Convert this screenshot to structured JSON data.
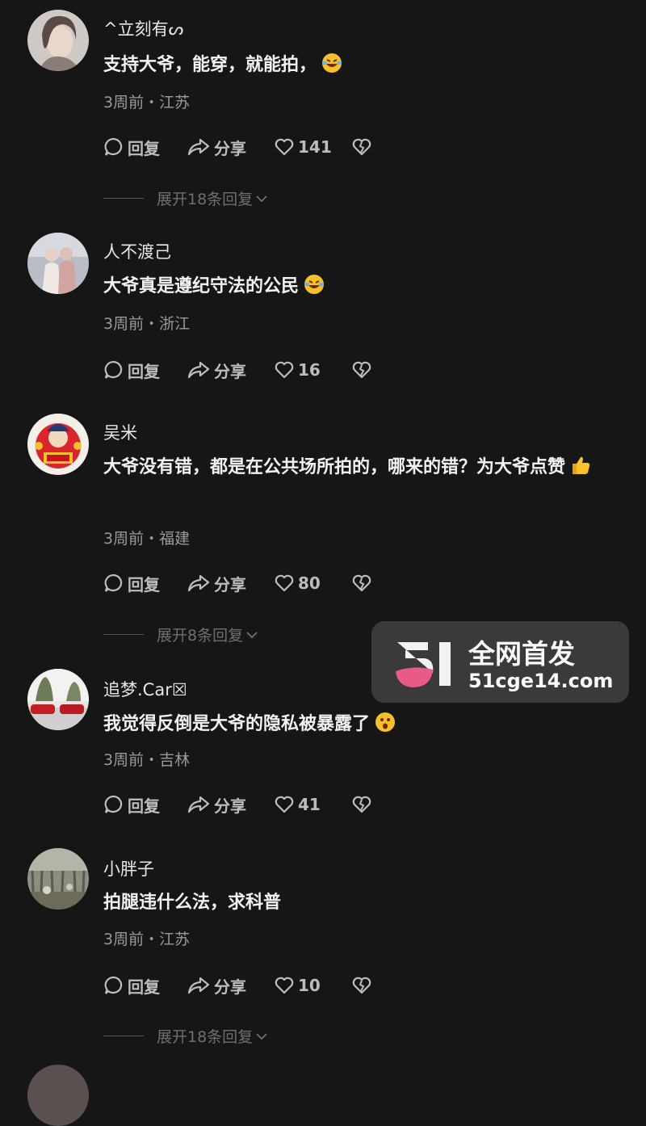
{
  "colors": {
    "background": "#161616",
    "text": "#f2f2f2",
    "meta": "#9a9a9a",
    "action": "#bdbdbd",
    "expand": "#6f6f6f",
    "watermark_bg": "#3c3c3c",
    "watermark_accent": "#e85b85"
  },
  "comments": [
    {
      "username": "^立刻有ᔕ",
      "text": "支持大爷，能穿，就能拍，",
      "emoji": "laughing-crying-emoji",
      "meta": "3周前・江苏",
      "actions": {
        "reply": "回复",
        "share": "分享",
        "likes": "141"
      },
      "expand": "展开18条回复"
    },
    {
      "username": "人不渡己",
      "text": "大爷真是遵纪守法的公民",
      "emoji": "laughing-crying-emoji",
      "meta": "3周前・浙江",
      "actions": {
        "reply": "回复",
        "share": "分享",
        "likes": "16"
      }
    },
    {
      "username": "吴米",
      "text": "大爷没有错，都是在公共场所拍的，哪来的错？为大爷点赞",
      "emoji": "thumbs-up-emoji",
      "meta": "3周前・福建",
      "actions": {
        "reply": "回复",
        "share": "分享",
        "likes": "80"
      },
      "expand": "展开8条回复"
    },
    {
      "username": "追梦.Car☒",
      "text": "我觉得反倒是大爷的隐私被暴露了",
      "emoji": "hushed-face-emoji",
      "meta": "3周前・吉林",
      "actions": {
        "reply": "回复",
        "share": "分享",
        "likes": "41"
      }
    },
    {
      "username": "小胖子",
      "text": "拍腿违什么法，求科普",
      "meta": "3周前・江苏",
      "actions": {
        "reply": "回复",
        "share": "分享",
        "likes": "10"
      },
      "expand": "展开18条回复"
    }
  ],
  "watermark": {
    "logo": "51",
    "title": "全网首发",
    "url": "51cge14.com"
  }
}
